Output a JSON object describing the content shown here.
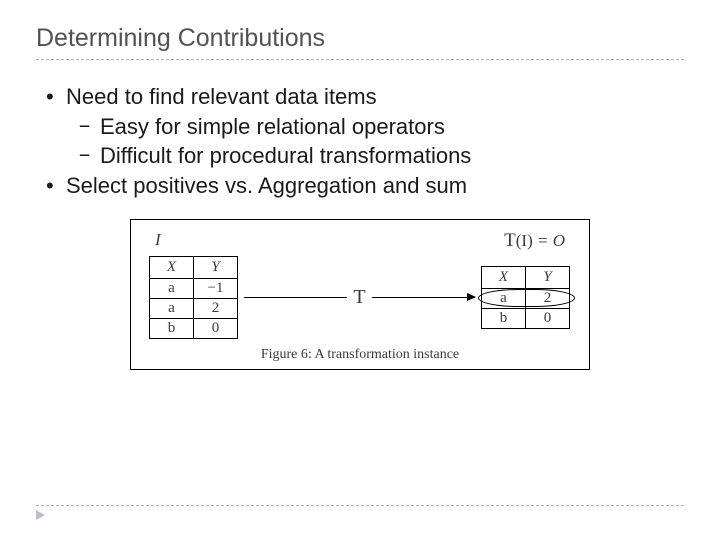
{
  "title": "Determining Contributions",
  "bullets": {
    "b1": "Need to find relevant data items",
    "b1a": "Easy for simple relational operators",
    "b1b": "Difficult for procedural transformations",
    "b2": "Select positives vs. Aggregation and sum"
  },
  "figure": {
    "left_label": "I",
    "right_label_func": "T",
    "right_label_arg": "(I)",
    "right_label_eq": " = O",
    "flow_label": "T",
    "left_table": {
      "h1": "X",
      "h2": "Y",
      "r1c1": "a",
      "r1c2": "−1",
      "r2c1": "a",
      "r2c2": "2",
      "r3c1": "b",
      "r3c2": "0"
    },
    "right_table": {
      "h1": "X",
      "h2": "Y",
      "r1c1": "a",
      "r1c2": "2",
      "r2c1": "b",
      "r2c2": "0"
    },
    "caption": "Figure 6: A transformation instance"
  }
}
